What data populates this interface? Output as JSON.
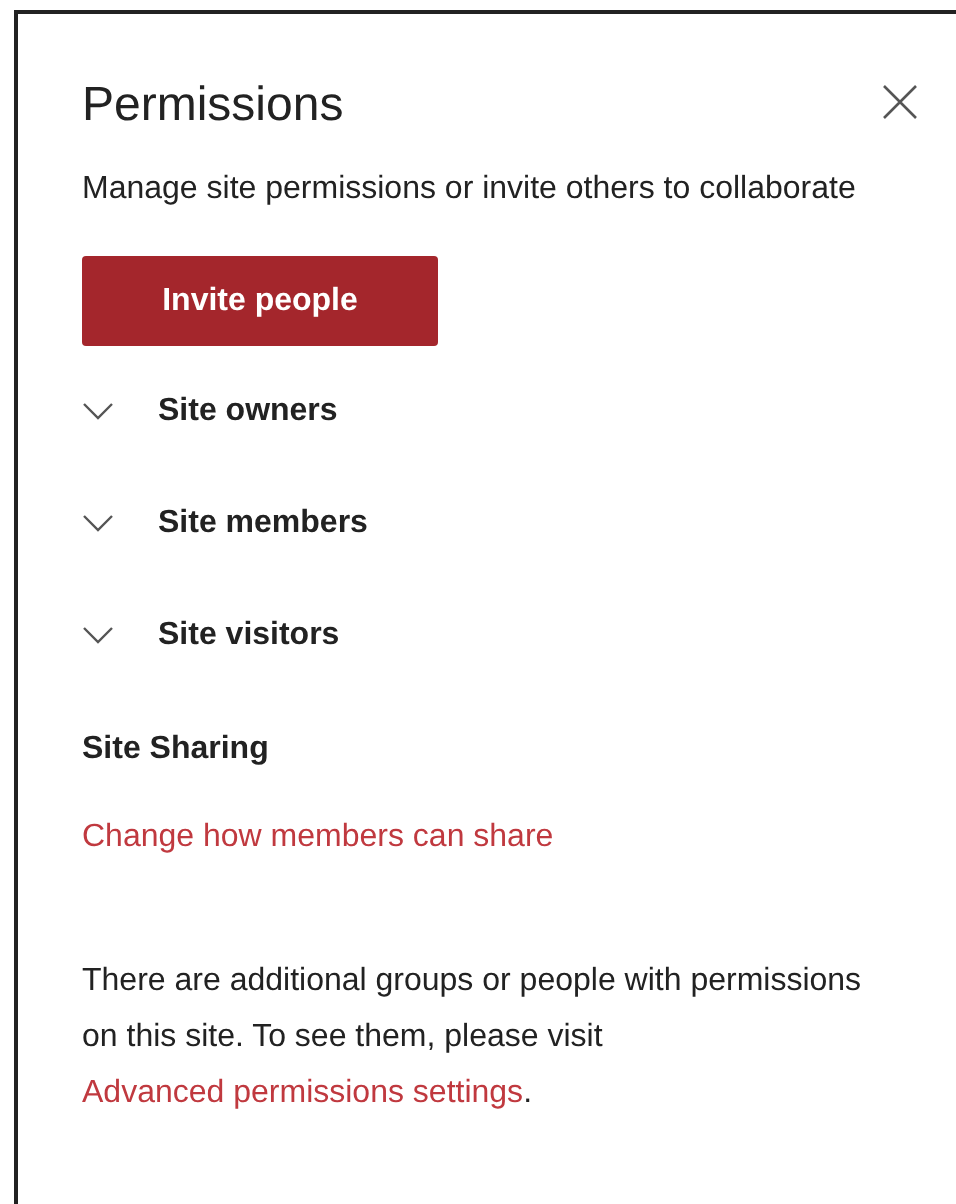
{
  "panel": {
    "title": "Permissions",
    "description": "Manage site permissions or invite others to collaborate",
    "invite_button": "Invite people"
  },
  "groups": [
    {
      "label": "Site owners",
      "expanded": false
    },
    {
      "label": "Site members",
      "expanded": false
    },
    {
      "label": "Site visitors",
      "expanded": false
    }
  ],
  "sharing": {
    "heading": "Site Sharing",
    "link": "Change how members can share"
  },
  "note": {
    "text": "There are additional groups or people with permissions on this site. To see them, please visit",
    "link": "Advanced permissions settings",
    "after": "."
  }
}
